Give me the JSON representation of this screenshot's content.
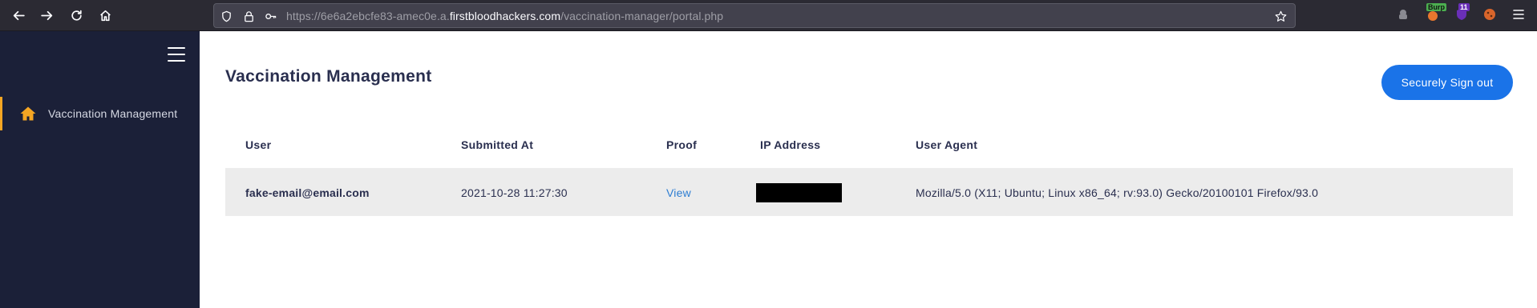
{
  "browser": {
    "url_prefix": "https://6e6a2ebcfe83-amec0e.a.",
    "url_host": "firstbloodhackers.com",
    "url_path": "/vaccination-manager/portal.php",
    "extensions": [
      {
        "name": "burp",
        "badge": "Burp"
      },
      {
        "name": "ublock",
        "badge": "11"
      }
    ]
  },
  "sidebar": {
    "items": [
      {
        "label": "Vaccination Management",
        "icon": "home-icon",
        "active": true
      }
    ],
    "accent": "#f5a623"
  },
  "main": {
    "title": "Vaccination Management",
    "signout_label": "Securely Sign out",
    "table": {
      "headers": [
        "User",
        "Submitted At",
        "Proof",
        "IP Address",
        "User Agent"
      ],
      "rows": [
        {
          "user": "fake-email@email.com",
          "submitted_at": "2021-10-28 11:27:30",
          "proof": "View",
          "ip_address": "",
          "user_agent": "Mozilla/5.0 (X11; Ubuntu; Linux x86_64; rv:93.0) Gecko/20100101 Firefox/93.0"
        }
      ]
    }
  },
  "colors": {
    "sidebar_bg": "#1b2038",
    "primary_button": "#1a73e8",
    "link": "#2d7dd2",
    "row_bg": "#ececec"
  }
}
